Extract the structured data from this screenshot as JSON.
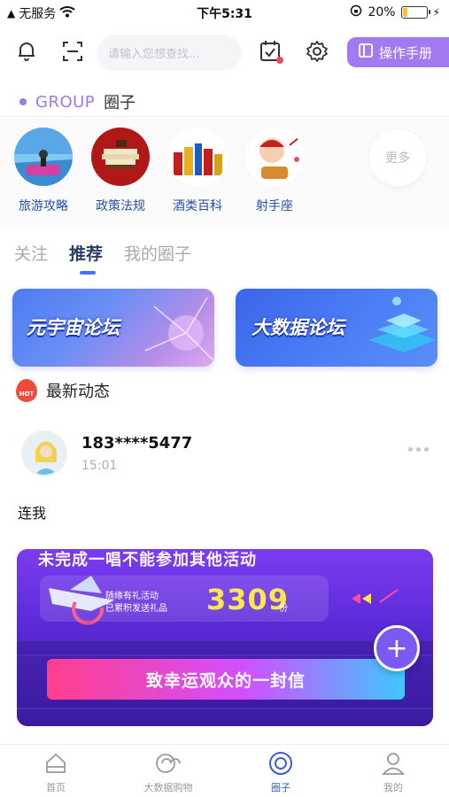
{
  "status_bar": {
    "carrier": "无服务",
    "time": "下午5:31",
    "battery": "20%",
    "battery_level": 0.2
  },
  "topbar": {
    "search_placeholder": "请输入您想查找...",
    "manual_label": "操作手册"
  },
  "group": {
    "en": "GROUP",
    "cn": "圈子"
  },
  "circles": [
    {
      "label": "旅游攻略"
    },
    {
      "label": "政策法规"
    },
    {
      "label": "酒类百科"
    },
    {
      "label": "射手座"
    }
  ],
  "circles_more": "更多",
  "tabs": [
    {
      "label": "关注"
    },
    {
      "label": "推荐"
    },
    {
      "label": "我的圈子"
    }
  ],
  "forums": [
    {
      "label": "元宇宙论坛"
    },
    {
      "label": "大数据论坛"
    }
  ],
  "latest": {
    "badge": "HOT",
    "title": "最新动态"
  },
  "post": {
    "username": "183****5477",
    "time": "15:01",
    "text": "连我",
    "image": {
      "top_text": "未完成一唱不能参加其他活动",
      "line1": "随缘有礼活动",
      "line2": "已累积发送礼品",
      "count": "3309",
      "unit": "份",
      "banner": "致幸运观众的一封信"
    }
  },
  "fab_label": "+",
  "bottom_nav": [
    {
      "label": "首页"
    },
    {
      "label": "大数据购物"
    },
    {
      "label": "圈子"
    },
    {
      "label": "我的"
    }
  ],
  "colors": {
    "accent": "#a37bf0",
    "nav_active": "#3a5fd8",
    "label_blue": "#2a4fa8"
  }
}
